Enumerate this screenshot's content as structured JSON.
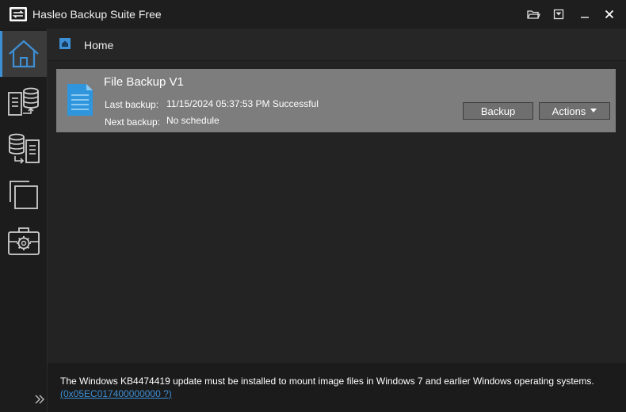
{
  "window": {
    "title": "Hasleo Backup Suite Free"
  },
  "breadcrumb": {
    "label": "Home"
  },
  "task": {
    "name": "File Backup V1",
    "last_backup_label": "Last backup:",
    "last_backup_value": "11/15/2024 05:37:53 PM Successful",
    "next_backup_label": "Next backup:",
    "next_backup_value": "No schedule",
    "backup_button": "Backup",
    "actions_button": "Actions"
  },
  "footer": {
    "message": "The Windows KB4474419 update must be installed to mount image files in Windows 7 and earlier Windows operating systems.",
    "link": "(0x05EC017400000000 ?)"
  },
  "sidebar": {
    "items": [
      {
        "icon": "home-icon",
        "active": true
      },
      {
        "icon": "backup-icon",
        "active": false
      },
      {
        "icon": "restore-icon",
        "active": false
      },
      {
        "icon": "clone-icon",
        "active": false
      },
      {
        "icon": "tools-icon",
        "active": false
      }
    ]
  },
  "colors": {
    "accent": "#3d8fd6",
    "card": "#7d7d7d",
    "background": "#232323"
  }
}
